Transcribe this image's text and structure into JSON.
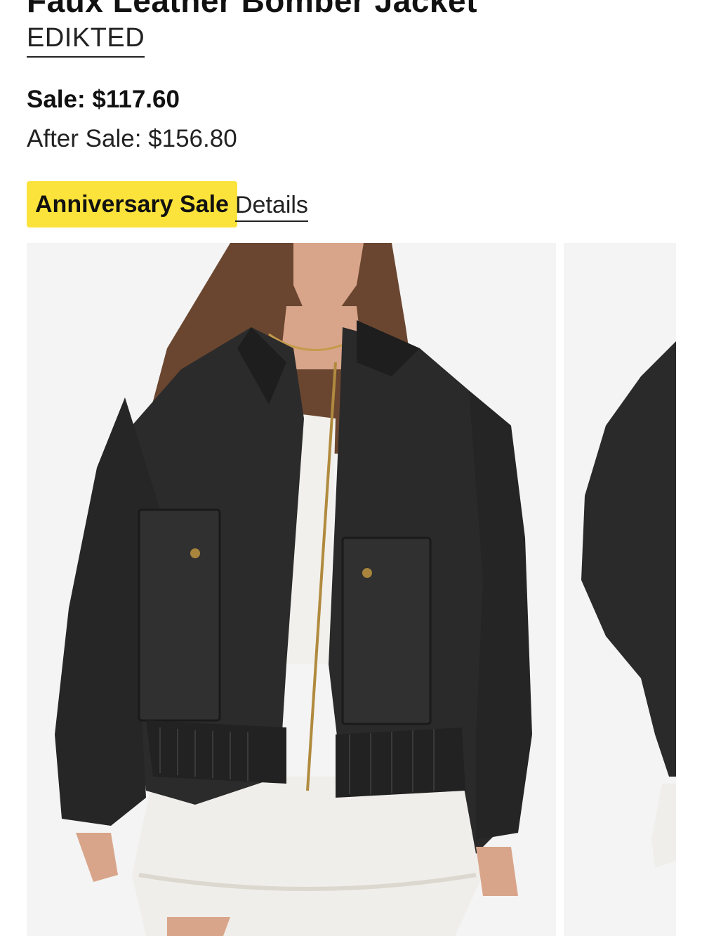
{
  "product": {
    "title": "Faux Leather Bomber Jacket",
    "brand": "EDIKTED",
    "sale_price": "Sale: $117.60",
    "after_sale_price": "After Sale: $156.80",
    "promo_badge": "Anniversary Sale",
    "details_link": "Details"
  },
  "gallery": {
    "images": [
      {
        "icon": "product-photo-front",
        "alt": "Model wearing black faux leather bomber jacket over white top and ruffled skirt"
      },
      {
        "icon": "product-photo-side",
        "alt": "Side view of bomber jacket"
      }
    ]
  },
  "colors": {
    "badge_bg": "#fbe33b",
    "photo_bg": "#f4f4f4",
    "jacket": "#2a2a2a"
  }
}
